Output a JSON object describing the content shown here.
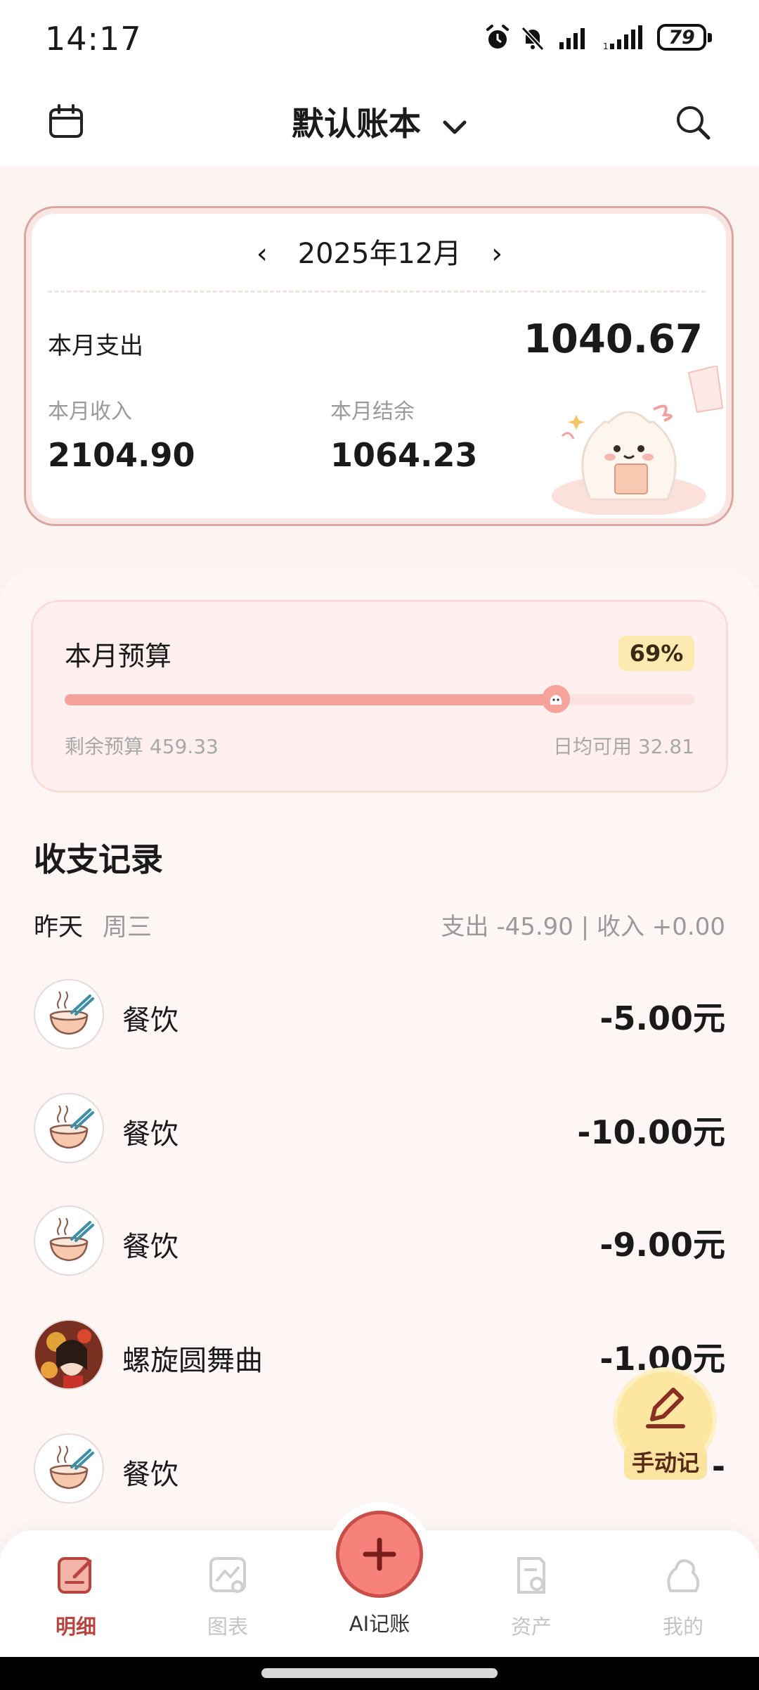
{
  "status_bar": {
    "time": "14:17",
    "battery": "79"
  },
  "header": {
    "book_title": "默认账本"
  },
  "summary": {
    "month": "2025年12月",
    "expense_label": "本月支出",
    "expense_value": "1040.67",
    "income_label": "本月收入",
    "income_value": "2104.90",
    "balance_label": "本月结余",
    "balance_value": "1064.23"
  },
  "budget": {
    "title": "本月预算",
    "percent_label": "69%",
    "progress": 0.78,
    "remaining": "剩余预算 459.33",
    "daily": "日均可用 32.81"
  },
  "records": {
    "title": "收支记录",
    "day": "昨天",
    "weekday": "周三",
    "day_summary": "支出 -45.90 | 收入 +0.00",
    "items": [
      {
        "category": "餐饮",
        "amount": "-5.00元",
        "icon": "noodle-bowl-icon"
      },
      {
        "category": "餐饮",
        "amount": "-10.00元",
        "icon": "noodle-bowl-icon"
      },
      {
        "category": "餐饮",
        "amount": "-9.00元",
        "icon": "noodle-bowl-icon"
      },
      {
        "category": "螺旋圆舞曲",
        "amount": "-1.00元",
        "icon": "avatar-portrait-icon"
      },
      {
        "category": "餐饮",
        "amount": "-",
        "icon": "noodle-bowl-icon"
      }
    ]
  },
  "fab": {
    "manual_label": "手动记"
  },
  "nav": {
    "items": [
      {
        "label": "明细",
        "icon": "details-icon",
        "active": true
      },
      {
        "label": "图表",
        "icon": "chart-icon",
        "active": false
      },
      {
        "label": "AI记账",
        "icon": "plus-icon",
        "active": false
      },
      {
        "label": "资产",
        "icon": "assets-icon",
        "active": false
      },
      {
        "label": "我的",
        "icon": "profile-icon",
        "active": false
      }
    ]
  },
  "colors": {
    "accent": "#f7827c",
    "budget_fill": "#f4a29c",
    "badge": "#fdeab0",
    "active_nav": "#b8443f"
  }
}
